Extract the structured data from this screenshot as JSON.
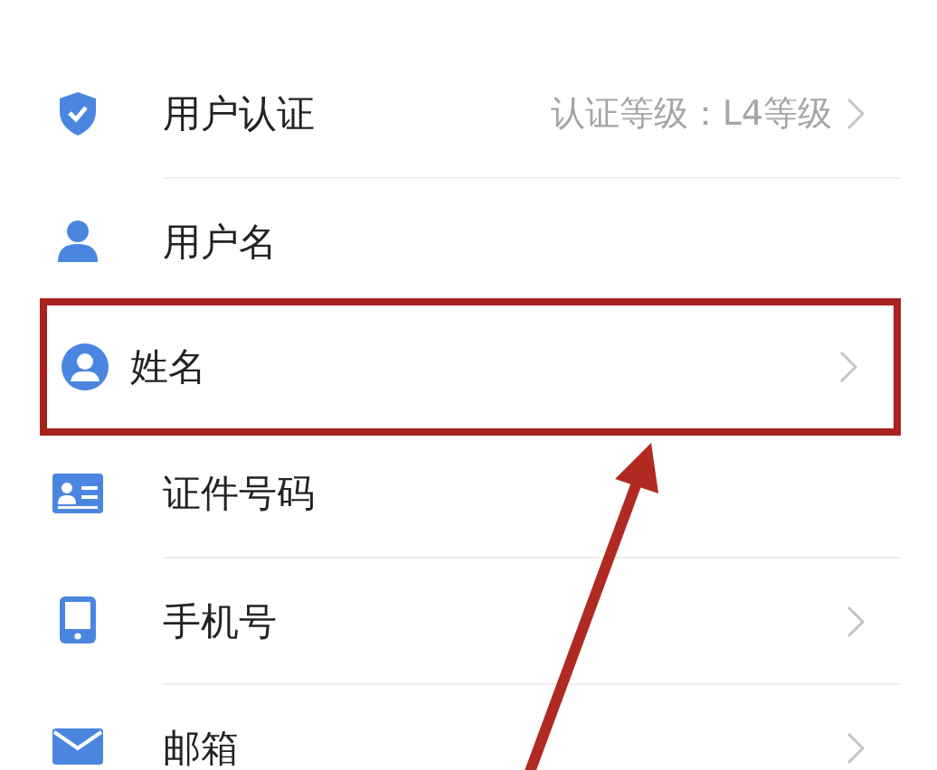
{
  "rows": [
    {
      "kind": "shield",
      "label": "用户认证",
      "value": "认证等级：L4等级",
      "chevron": true,
      "highlighted": false
    },
    {
      "kind": "person",
      "label": "用户名",
      "chevron": false,
      "highlighted": false
    },
    {
      "kind": "avatar",
      "label": "姓名",
      "chevron": true,
      "highlighted": true
    },
    {
      "kind": "idcard",
      "label": "证件号码",
      "chevron": false,
      "highlighted": false
    },
    {
      "kind": "phone",
      "label": "手机号",
      "chevron": true,
      "highlighted": false
    },
    {
      "kind": "mail",
      "label": "邮箱",
      "chevron": true,
      "highlighted": false
    }
  ]
}
